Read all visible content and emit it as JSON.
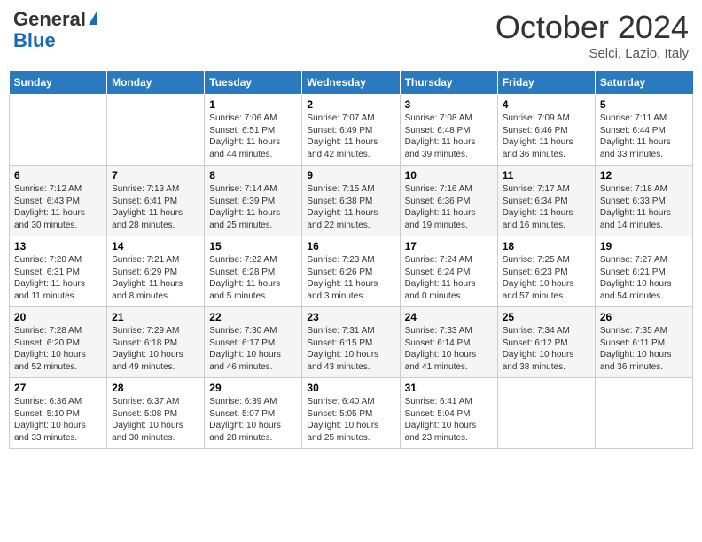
{
  "header": {
    "logo_general": "General",
    "logo_blue": "Blue",
    "month": "October 2024",
    "location": "Selci, Lazio, Italy"
  },
  "days_of_week": [
    "Sunday",
    "Monday",
    "Tuesday",
    "Wednesday",
    "Thursday",
    "Friday",
    "Saturday"
  ],
  "weeks": [
    [
      {
        "day": "",
        "sunrise": "",
        "sunset": "",
        "daylight": ""
      },
      {
        "day": "",
        "sunrise": "",
        "sunset": "",
        "daylight": ""
      },
      {
        "day": "1",
        "sunrise": "Sunrise: 7:06 AM",
        "sunset": "Sunset: 6:51 PM",
        "daylight": "Daylight: 11 hours and 44 minutes."
      },
      {
        "day": "2",
        "sunrise": "Sunrise: 7:07 AM",
        "sunset": "Sunset: 6:49 PM",
        "daylight": "Daylight: 11 hours and 42 minutes."
      },
      {
        "day": "3",
        "sunrise": "Sunrise: 7:08 AM",
        "sunset": "Sunset: 6:48 PM",
        "daylight": "Daylight: 11 hours and 39 minutes."
      },
      {
        "day": "4",
        "sunrise": "Sunrise: 7:09 AM",
        "sunset": "Sunset: 6:46 PM",
        "daylight": "Daylight: 11 hours and 36 minutes."
      },
      {
        "day": "5",
        "sunrise": "Sunrise: 7:11 AM",
        "sunset": "Sunset: 6:44 PM",
        "daylight": "Daylight: 11 hours and 33 minutes."
      }
    ],
    [
      {
        "day": "6",
        "sunrise": "Sunrise: 7:12 AM",
        "sunset": "Sunset: 6:43 PM",
        "daylight": "Daylight: 11 hours and 30 minutes."
      },
      {
        "day": "7",
        "sunrise": "Sunrise: 7:13 AM",
        "sunset": "Sunset: 6:41 PM",
        "daylight": "Daylight: 11 hours and 28 minutes."
      },
      {
        "day": "8",
        "sunrise": "Sunrise: 7:14 AM",
        "sunset": "Sunset: 6:39 PM",
        "daylight": "Daylight: 11 hours and 25 minutes."
      },
      {
        "day": "9",
        "sunrise": "Sunrise: 7:15 AM",
        "sunset": "Sunset: 6:38 PM",
        "daylight": "Daylight: 11 hours and 22 minutes."
      },
      {
        "day": "10",
        "sunrise": "Sunrise: 7:16 AM",
        "sunset": "Sunset: 6:36 PM",
        "daylight": "Daylight: 11 hours and 19 minutes."
      },
      {
        "day": "11",
        "sunrise": "Sunrise: 7:17 AM",
        "sunset": "Sunset: 6:34 PM",
        "daylight": "Daylight: 11 hours and 16 minutes."
      },
      {
        "day": "12",
        "sunrise": "Sunrise: 7:18 AM",
        "sunset": "Sunset: 6:33 PM",
        "daylight": "Daylight: 11 hours and 14 minutes."
      }
    ],
    [
      {
        "day": "13",
        "sunrise": "Sunrise: 7:20 AM",
        "sunset": "Sunset: 6:31 PM",
        "daylight": "Daylight: 11 hours and 11 minutes."
      },
      {
        "day": "14",
        "sunrise": "Sunrise: 7:21 AM",
        "sunset": "Sunset: 6:29 PM",
        "daylight": "Daylight: 11 hours and 8 minutes."
      },
      {
        "day": "15",
        "sunrise": "Sunrise: 7:22 AM",
        "sunset": "Sunset: 6:28 PM",
        "daylight": "Daylight: 11 hours and 5 minutes."
      },
      {
        "day": "16",
        "sunrise": "Sunrise: 7:23 AM",
        "sunset": "Sunset: 6:26 PM",
        "daylight": "Daylight: 11 hours and 3 minutes."
      },
      {
        "day": "17",
        "sunrise": "Sunrise: 7:24 AM",
        "sunset": "Sunset: 6:24 PM",
        "daylight": "Daylight: 11 hours and 0 minutes."
      },
      {
        "day": "18",
        "sunrise": "Sunrise: 7:25 AM",
        "sunset": "Sunset: 6:23 PM",
        "daylight": "Daylight: 10 hours and 57 minutes."
      },
      {
        "day": "19",
        "sunrise": "Sunrise: 7:27 AM",
        "sunset": "Sunset: 6:21 PM",
        "daylight": "Daylight: 10 hours and 54 minutes."
      }
    ],
    [
      {
        "day": "20",
        "sunrise": "Sunrise: 7:28 AM",
        "sunset": "Sunset: 6:20 PM",
        "daylight": "Daylight: 10 hours and 52 minutes."
      },
      {
        "day": "21",
        "sunrise": "Sunrise: 7:29 AM",
        "sunset": "Sunset: 6:18 PM",
        "daylight": "Daylight: 10 hours and 49 minutes."
      },
      {
        "day": "22",
        "sunrise": "Sunrise: 7:30 AM",
        "sunset": "Sunset: 6:17 PM",
        "daylight": "Daylight: 10 hours and 46 minutes."
      },
      {
        "day": "23",
        "sunrise": "Sunrise: 7:31 AM",
        "sunset": "Sunset: 6:15 PM",
        "daylight": "Daylight: 10 hours and 43 minutes."
      },
      {
        "day": "24",
        "sunrise": "Sunrise: 7:33 AM",
        "sunset": "Sunset: 6:14 PM",
        "daylight": "Daylight: 10 hours and 41 minutes."
      },
      {
        "day": "25",
        "sunrise": "Sunrise: 7:34 AM",
        "sunset": "Sunset: 6:12 PM",
        "daylight": "Daylight: 10 hours and 38 minutes."
      },
      {
        "day": "26",
        "sunrise": "Sunrise: 7:35 AM",
        "sunset": "Sunset: 6:11 PM",
        "daylight": "Daylight: 10 hours and 36 minutes."
      }
    ],
    [
      {
        "day": "27",
        "sunrise": "Sunrise: 6:36 AM",
        "sunset": "Sunset: 5:10 PM",
        "daylight": "Daylight: 10 hours and 33 minutes."
      },
      {
        "day": "28",
        "sunrise": "Sunrise: 6:37 AM",
        "sunset": "Sunset: 5:08 PM",
        "daylight": "Daylight: 10 hours and 30 minutes."
      },
      {
        "day": "29",
        "sunrise": "Sunrise: 6:39 AM",
        "sunset": "Sunset: 5:07 PM",
        "daylight": "Daylight: 10 hours and 28 minutes."
      },
      {
        "day": "30",
        "sunrise": "Sunrise: 6:40 AM",
        "sunset": "Sunset: 5:05 PM",
        "daylight": "Daylight: 10 hours and 25 minutes."
      },
      {
        "day": "31",
        "sunrise": "Sunrise: 6:41 AM",
        "sunset": "Sunset: 5:04 PM",
        "daylight": "Daylight: 10 hours and 23 minutes."
      },
      {
        "day": "",
        "sunrise": "",
        "sunset": "",
        "daylight": ""
      },
      {
        "day": "",
        "sunrise": "",
        "sunset": "",
        "daylight": ""
      }
    ]
  ]
}
